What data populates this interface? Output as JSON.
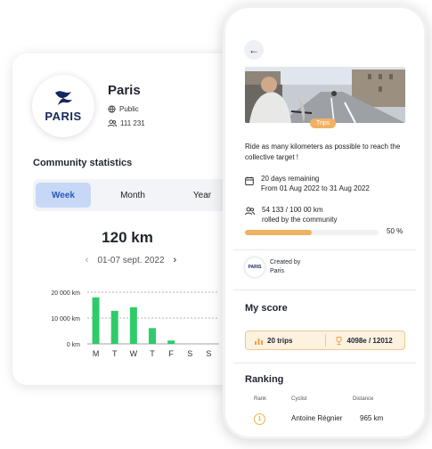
{
  "community": {
    "logo_text": "PARIS",
    "name": "Paris",
    "visibility": "Public",
    "members": "111 231",
    "stats_title": "Community statistics",
    "tabs": [
      "Week",
      "Month",
      "Year"
    ],
    "active_tab": "Week",
    "total": "120 km",
    "date_range": "01-07 sept. 2022"
  },
  "chart_data": {
    "type": "bar",
    "categories": [
      "M",
      "T",
      "W",
      "T",
      "F",
      "S",
      "S"
    ],
    "values": [
      18000,
      12800,
      14200,
      6100,
      1300,
      0,
      0
    ],
    "y_ticks": [
      "20 000 km",
      "10 000 km",
      "0 km"
    ],
    "ylim": [
      0,
      20000
    ],
    "bar_color": "#2fcb6b"
  },
  "challenge": {
    "badge": "Trips",
    "description": "Ride as many kilometers as possible to reach the collective target !",
    "days_remaining": "20 days remaining",
    "period": "From 01 Aug 2022 to 31 Aug 2022",
    "progress_value": "54 133 / 100 00 km",
    "progress_caption": "rolled by the community",
    "progress_fraction": 0.5,
    "progress_pct": "50 %",
    "created_by_label": "Created by",
    "creator": "Paris",
    "creator_logo_text": "PARIS"
  },
  "score": {
    "title": "My score",
    "trips": "20 trips",
    "rank": "4098e / 12012"
  },
  "ranking": {
    "title": "Ranking",
    "headers": [
      "Rank",
      "Cyclist",
      "Distance"
    ],
    "rows": [
      {
        "rank": "1",
        "cyclist": "Antoine Régnier",
        "distance": "965 km"
      }
    ]
  },
  "colors": {
    "accent": "#f0b260",
    "tab_active": "#c7d8f6",
    "brand_blue": "#16275c"
  }
}
